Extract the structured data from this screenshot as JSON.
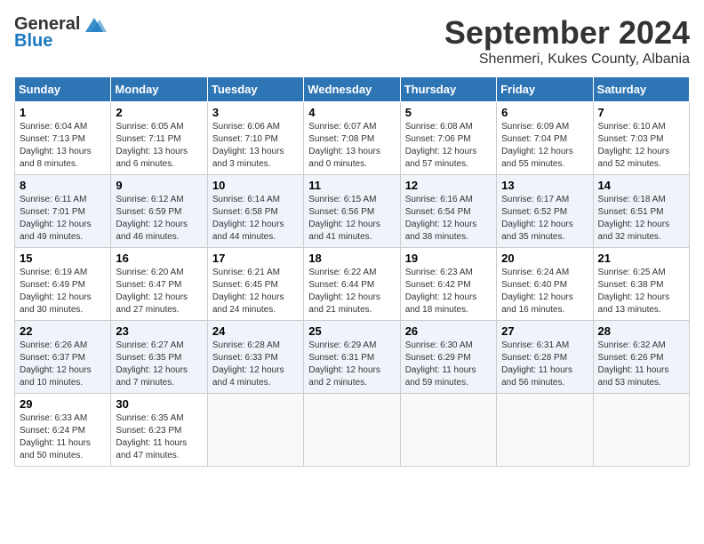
{
  "header": {
    "logo_general": "General",
    "logo_blue": "Blue",
    "month": "September 2024",
    "location": "Shenmeri, Kukes County, Albania"
  },
  "days_of_week": [
    "Sunday",
    "Monday",
    "Tuesday",
    "Wednesday",
    "Thursday",
    "Friday",
    "Saturday"
  ],
  "weeks": [
    [
      {
        "day": "1",
        "sunrise": "6:04 AM",
        "sunset": "7:13 PM",
        "daylight": "13 hours and 8 minutes."
      },
      {
        "day": "2",
        "sunrise": "6:05 AM",
        "sunset": "7:11 PM",
        "daylight": "13 hours and 6 minutes."
      },
      {
        "day": "3",
        "sunrise": "6:06 AM",
        "sunset": "7:10 PM",
        "daylight": "13 hours and 3 minutes."
      },
      {
        "day": "4",
        "sunrise": "6:07 AM",
        "sunset": "7:08 PM",
        "daylight": "13 hours and 0 minutes."
      },
      {
        "day": "5",
        "sunrise": "6:08 AM",
        "sunset": "7:06 PM",
        "daylight": "12 hours and 57 minutes."
      },
      {
        "day": "6",
        "sunrise": "6:09 AM",
        "sunset": "7:04 PM",
        "daylight": "12 hours and 55 minutes."
      },
      {
        "day": "7",
        "sunrise": "6:10 AM",
        "sunset": "7:03 PM",
        "daylight": "12 hours and 52 minutes."
      }
    ],
    [
      {
        "day": "8",
        "sunrise": "6:11 AM",
        "sunset": "7:01 PM",
        "daylight": "12 hours and 49 minutes."
      },
      {
        "day": "9",
        "sunrise": "6:12 AM",
        "sunset": "6:59 PM",
        "daylight": "12 hours and 46 minutes."
      },
      {
        "day": "10",
        "sunrise": "6:14 AM",
        "sunset": "6:58 PM",
        "daylight": "12 hours and 44 minutes."
      },
      {
        "day": "11",
        "sunrise": "6:15 AM",
        "sunset": "6:56 PM",
        "daylight": "12 hours and 41 minutes."
      },
      {
        "day": "12",
        "sunrise": "6:16 AM",
        "sunset": "6:54 PM",
        "daylight": "12 hours and 38 minutes."
      },
      {
        "day": "13",
        "sunrise": "6:17 AM",
        "sunset": "6:52 PM",
        "daylight": "12 hours and 35 minutes."
      },
      {
        "day": "14",
        "sunrise": "6:18 AM",
        "sunset": "6:51 PM",
        "daylight": "12 hours and 32 minutes."
      }
    ],
    [
      {
        "day": "15",
        "sunrise": "6:19 AM",
        "sunset": "6:49 PM",
        "daylight": "12 hours and 30 minutes."
      },
      {
        "day": "16",
        "sunrise": "6:20 AM",
        "sunset": "6:47 PM",
        "daylight": "12 hours and 27 minutes."
      },
      {
        "day": "17",
        "sunrise": "6:21 AM",
        "sunset": "6:45 PM",
        "daylight": "12 hours and 24 minutes."
      },
      {
        "day": "18",
        "sunrise": "6:22 AM",
        "sunset": "6:44 PM",
        "daylight": "12 hours and 21 minutes."
      },
      {
        "day": "19",
        "sunrise": "6:23 AM",
        "sunset": "6:42 PM",
        "daylight": "12 hours and 18 minutes."
      },
      {
        "day": "20",
        "sunrise": "6:24 AM",
        "sunset": "6:40 PM",
        "daylight": "12 hours and 16 minutes."
      },
      {
        "day": "21",
        "sunrise": "6:25 AM",
        "sunset": "6:38 PM",
        "daylight": "12 hours and 13 minutes."
      }
    ],
    [
      {
        "day": "22",
        "sunrise": "6:26 AM",
        "sunset": "6:37 PM",
        "daylight": "12 hours and 10 minutes."
      },
      {
        "day": "23",
        "sunrise": "6:27 AM",
        "sunset": "6:35 PM",
        "daylight": "12 hours and 7 minutes."
      },
      {
        "day": "24",
        "sunrise": "6:28 AM",
        "sunset": "6:33 PM",
        "daylight": "12 hours and 4 minutes."
      },
      {
        "day": "25",
        "sunrise": "6:29 AM",
        "sunset": "6:31 PM",
        "daylight": "12 hours and 2 minutes."
      },
      {
        "day": "26",
        "sunrise": "6:30 AM",
        "sunset": "6:29 PM",
        "daylight": "11 hours and 59 minutes."
      },
      {
        "day": "27",
        "sunrise": "6:31 AM",
        "sunset": "6:28 PM",
        "daylight": "11 hours and 56 minutes."
      },
      {
        "day": "28",
        "sunrise": "6:32 AM",
        "sunset": "6:26 PM",
        "daylight": "11 hours and 53 minutes."
      }
    ],
    [
      {
        "day": "29",
        "sunrise": "6:33 AM",
        "sunset": "6:24 PM",
        "daylight": "11 hours and 50 minutes."
      },
      {
        "day": "30",
        "sunrise": "6:35 AM",
        "sunset": "6:23 PM",
        "daylight": "11 hours and 47 minutes."
      },
      null,
      null,
      null,
      null,
      null
    ]
  ]
}
